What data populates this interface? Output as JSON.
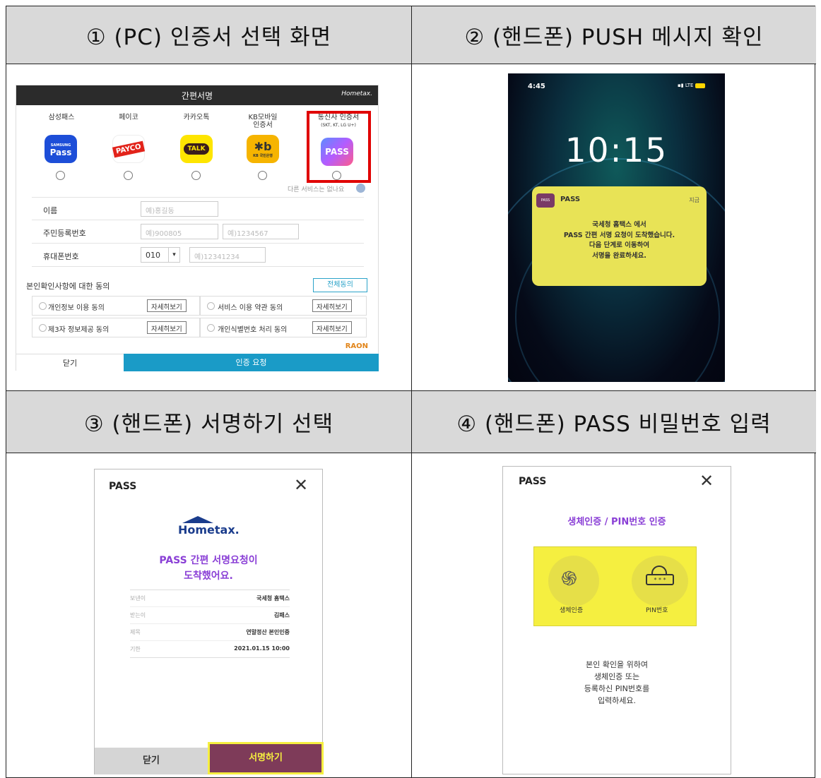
{
  "headers": {
    "h1": "① (PC) 인증서 선택 화면",
    "h2": "② (핸드폰) PUSH 메시지 확인",
    "h3": "③ (핸드폰) 서명하기 선택",
    "h4": "④ (핸드폰) PASS 비밀번호 입력"
  },
  "pc": {
    "title": "간편서명",
    "logo": "Hometax.",
    "providers": [
      {
        "label": "삼성패스",
        "icon": "Pass",
        "icon_sub": "SAMSUNG",
        "color": "#1d4ed8"
      },
      {
        "label": "페이코",
        "icon": "PAYCO",
        "color": "#ffffff"
      },
      {
        "label": "카카오톡",
        "icon": "TALK",
        "color": "#fee500"
      },
      {
        "label": "KB모바일\n인증서",
        "icon": "KB 국민은행",
        "color": "#f6b400"
      },
      {
        "label": "통신사 인증서",
        "sublabel": "(SKT, KT, LG U+)",
        "icon": "PASS",
        "color": "#7c5cff"
      }
    ],
    "other_service": "다른 서비스는 없나요",
    "fields": {
      "name_label": "이름",
      "name_placeholder": "예)홍길동",
      "rrn_label": "주민등록번호",
      "rrn_placeholder1": "예)900805",
      "rrn_placeholder2": "예)1234567",
      "phone_label": "휴대폰번호",
      "phone_prefix": "010",
      "phone_placeholder": "예)12341234"
    },
    "consent_title": "본인확인사항에 대한 동의",
    "consent_all": "전체동의",
    "consents": [
      {
        "label": "개인정보 이용 동의",
        "button": "자세히보기"
      },
      {
        "label": "서비스 이용 약관 동의",
        "button": "자세히보기"
      },
      {
        "label": "제3자 정보제공 동의",
        "button": "자세히보기"
      },
      {
        "label": "개인식별번호 처리 동의",
        "button": "자세히보기"
      }
    ],
    "raon": "RAON",
    "close": "닫기",
    "request": "인증 요청"
  },
  "lock": {
    "status_time": "4:45",
    "status_right": "LTE",
    "clock": "10:15",
    "app_icon": "PASS",
    "app_name": "PASS",
    "notif_time": "지금",
    "notif_lines": [
      "국세청 홈택스 에서",
      "PASS 간편 서명 요청이 도착했습니다.",
      "다음 단계로 이동하여",
      "서명을 완료하세요."
    ]
  },
  "sign": {
    "app": "PASS",
    "logo": "Hometax.",
    "title_lines": [
      "PASS 간편 서명요청이",
      "도착했어요."
    ],
    "rows": [
      {
        "k": "보낸이",
        "v": "국세청 홈택스"
      },
      {
        "k": "받는이",
        "v": "김패스"
      },
      {
        "k": "제목",
        "v": "연말정산 본인인증"
      },
      {
        "k": "기한",
        "v": "2021.01.15 10:00"
      }
    ],
    "close": "닫기",
    "sign": "서명하기"
  },
  "pin": {
    "app": "PASS",
    "title": "생체인증 / PIN번호 인증",
    "bio_label": "생체인증",
    "pin_label": "PIN번호",
    "pin_stars": "* * *",
    "desc_lines": [
      "본인 확인을 위하여",
      "생체인증 또는",
      "등록하신 PIN번호를",
      "입력하세요."
    ]
  }
}
